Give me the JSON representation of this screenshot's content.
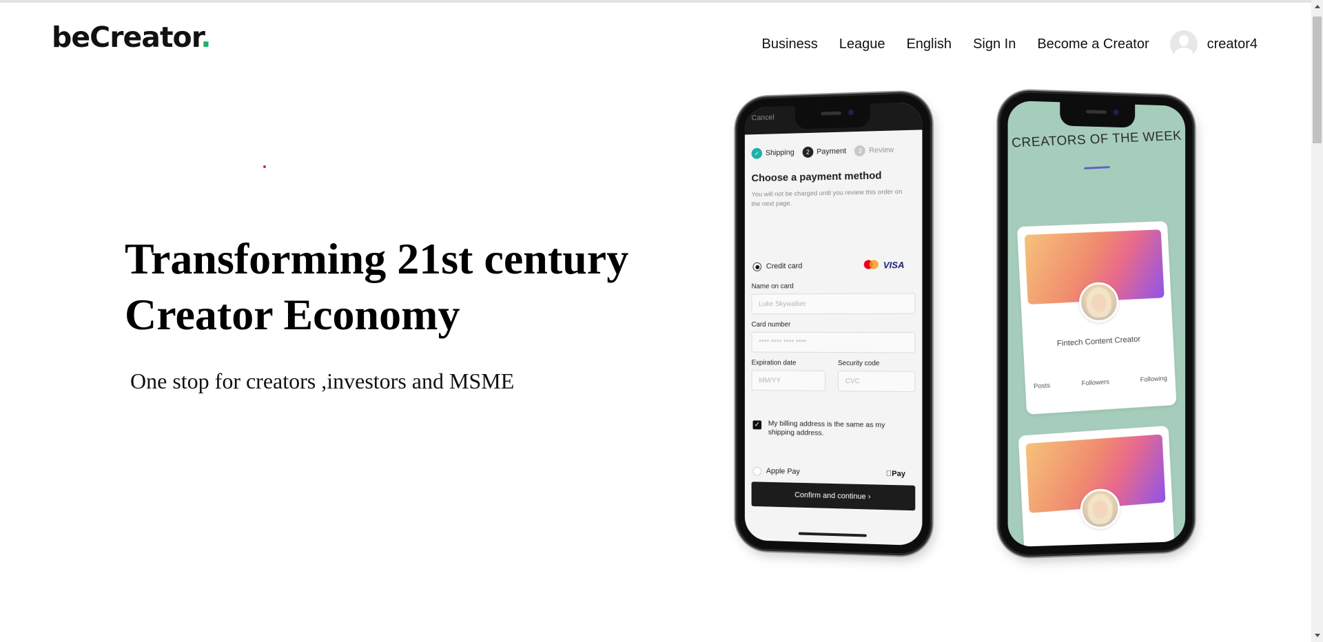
{
  "brand": {
    "name": "beCreator",
    "dot": ".",
    "dot_color": "#19b36b"
  },
  "nav": {
    "items": [
      "Business",
      "League",
      "English",
      "Sign In",
      "Become a Creator"
    ],
    "user": {
      "name": "creator4",
      "avatar_icon": "user-avatar-icon"
    }
  },
  "hero": {
    "headline_line1": "Transforming 21st century",
    "headline_line2": "Creator Economy",
    "subline": "One stop for creators ,investors and MSME"
  },
  "phone_payment": {
    "cancel": "Cancel",
    "steps": [
      {
        "label": "Shipping",
        "marker": "✓",
        "state": "done"
      },
      {
        "label": "Payment",
        "marker": "2",
        "state": "active"
      },
      {
        "label": "Review",
        "marker": "3",
        "state": "todo"
      }
    ],
    "title": "Choose a payment method",
    "note": "You will not be charged until you review this order on the next page.",
    "credit_card_label": "Credit card",
    "card_brand_text": "VISA",
    "name_label": "Name on card",
    "name_placeholder": "Luke Skywalker",
    "number_label": "Card number",
    "number_placeholder": "**** **** **** ****",
    "expiry_label": "Expiration date",
    "expiry_placeholder": "MM/YY",
    "cvc_label": "Security code",
    "cvc_placeholder": "CVC",
    "billing_label": "My billing address is the same as my shipping address.",
    "apple_pay_label": "Apple Pay",
    "apple_pay_logo": "Pay",
    "confirm_label": "Confirm and continue  ›"
  },
  "phone_creators": {
    "heading": "CREATORS OF THE WEEK",
    "accent_color": "#5c63c9",
    "card": {
      "role": "Fintech Content Creator",
      "stats": [
        "Posts",
        "Followers",
        "Following"
      ]
    }
  }
}
